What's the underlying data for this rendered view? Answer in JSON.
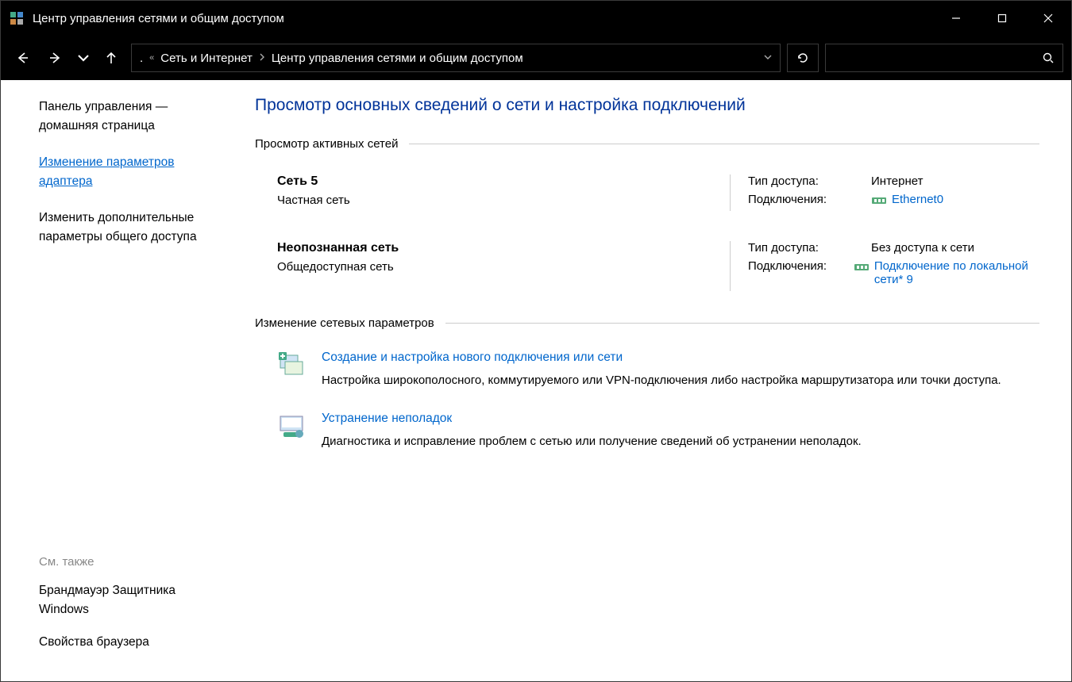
{
  "window": {
    "title": "Центр управления сетями и общим доступом"
  },
  "breadcrumb": {
    "prefix": ".",
    "sep1": "«",
    "item1": "Сеть и Интернет",
    "item2": "Центр управления сетями и общим доступом"
  },
  "sidebar": {
    "home": "Панель управления — домашняя страница",
    "adapter": "Изменение параметров адаптера",
    "sharing": "Изменить дополнительные параметры общего доступа",
    "see_also_title": "См. также",
    "firewall": "Брандмауэр Защитника Windows",
    "browser": "Свойства браузера"
  },
  "main": {
    "heading": "Просмотр основных сведений о сети и настройка подключений",
    "active_nets": "Просмотр активных сетей",
    "change_settings": "Изменение сетевых параметров",
    "access_label": "Тип доступа:",
    "conn_label": "Подключения:"
  },
  "net1": {
    "name": "Сеть 5",
    "type": "Частная сеть",
    "access": "Интернет",
    "conn": "Ethernet0"
  },
  "net2": {
    "name": "Неопознанная сеть",
    "type": "Общедоступная сеть",
    "access": "Без доступа к сети",
    "conn": "Подключение по локальной сети* 9"
  },
  "task1": {
    "title": "Создание и настройка нового подключения или сети",
    "desc": "Настройка широкополосного, коммутируемого или VPN-подключения либо настройка маршрутизатора или точки доступа."
  },
  "task2": {
    "title": "Устранение неполадок",
    "desc": "Диагностика и исправление проблем с сетью или получение сведений об устранении неполадок."
  }
}
